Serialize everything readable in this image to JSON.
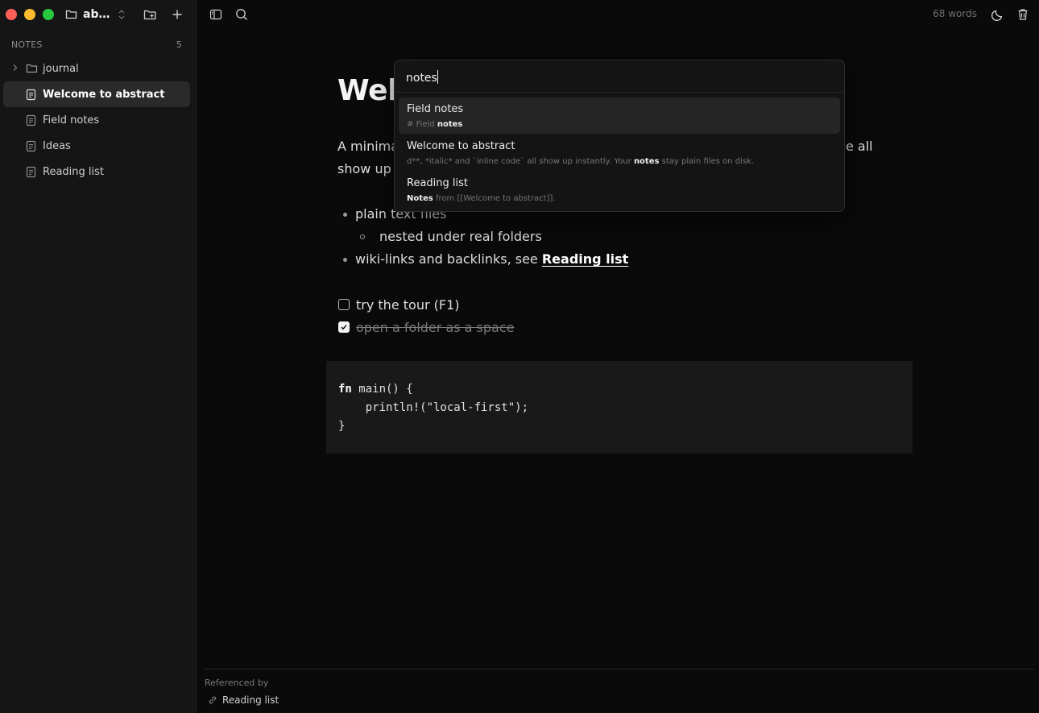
{
  "window": {
    "traffic_lights": [
      {
        "name": "close",
        "color": "#ff5f57"
      },
      {
        "name": "minimize",
        "color": "#febc2e"
      },
      {
        "name": "zoom",
        "color": "#28c840"
      }
    ]
  },
  "sidebar": {
    "workspace_name": "ab…",
    "section_label": "NOTES",
    "note_count": "5",
    "items": [
      {
        "label": "journal",
        "type": "folder"
      },
      {
        "label": "Welcome to abstract",
        "type": "note",
        "active": true
      },
      {
        "label": "Field notes",
        "type": "note"
      },
      {
        "label": "Ideas",
        "type": "note"
      },
      {
        "label": "Reading list",
        "type": "note"
      }
    ]
  },
  "toolbar": {
    "word_count": "68 words"
  },
  "document": {
    "title": "Welc",
    "para_line1_start": "A minima",
    "para_line1_end": "e all",
    "para_line2_start": "show up i",
    "bullets": [
      {
        "text": "plain text files",
        "level": 0
      },
      {
        "text": "nested under real folders",
        "level": 1
      },
      {
        "text": "wiki-links and backlinks, see ",
        "link": "Reading list",
        "level": 0
      }
    ],
    "tasks": [
      {
        "label": "try the tour (F1)",
        "done": false
      },
      {
        "label": "open a folder as a space",
        "done": true
      }
    ],
    "code": {
      "keyword": "fn",
      "line1_rest": " main() {",
      "line2": "    println!(\"local-first\");",
      "line3": "}"
    }
  },
  "backlinks": {
    "title": "Referenced by",
    "items": [
      "Reading list"
    ]
  },
  "search": {
    "query": "notes",
    "results": [
      {
        "title": "Field notes",
        "snippet_pre": "# Field ",
        "snippet_match": "notes",
        "snippet_post": "",
        "selected": true
      },
      {
        "title": "Welcome to abstract",
        "snippet_pre": "d**, *italic* and `inline code` all show up instantly. Your ",
        "snippet_match": "notes",
        "snippet_post": " stay plain files on disk.",
        "selected": false
      },
      {
        "title": "Reading list",
        "snippet_pre": "",
        "snippet_match": "Notes",
        "snippet_post": " from [[Welcome to abstract]].",
        "selected": false
      }
    ]
  }
}
